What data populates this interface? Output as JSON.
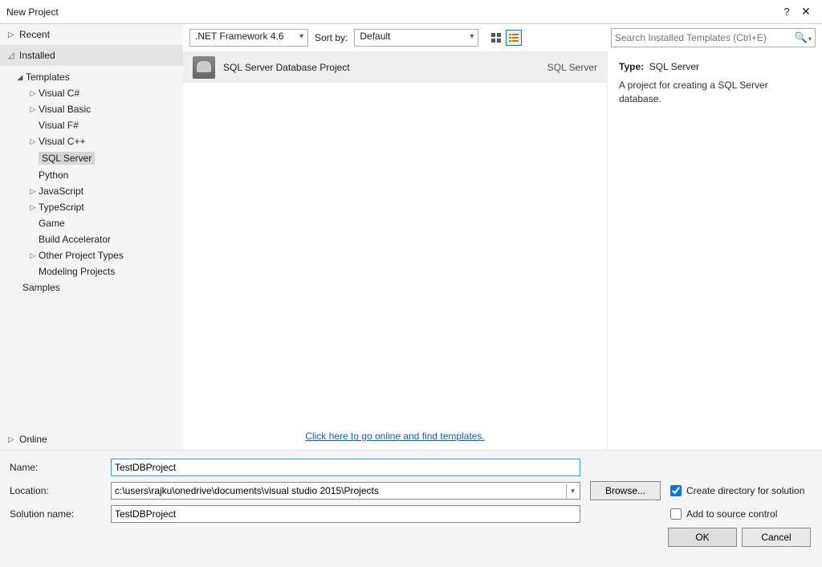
{
  "window": {
    "title": "New Project"
  },
  "nav": {
    "recent": "Recent",
    "installed": "Installed",
    "online": "Online",
    "templates": "Templates",
    "samples": "Samples",
    "items": [
      {
        "label": "Visual C#",
        "expandable": true
      },
      {
        "label": "Visual Basic",
        "expandable": true
      },
      {
        "label": "Visual F#",
        "expandable": false
      },
      {
        "label": "Visual C++",
        "expandable": true
      },
      {
        "label": "SQL Server",
        "expandable": false,
        "selected": true
      },
      {
        "label": "Python",
        "expandable": false
      },
      {
        "label": "JavaScript",
        "expandable": true
      },
      {
        "label": "TypeScript",
        "expandable": true
      },
      {
        "label": "Game",
        "expandable": false
      },
      {
        "label": "Build Accelerator",
        "expandable": false
      },
      {
        "label": "Other Project Types",
        "expandable": true
      },
      {
        "label": "Modeling Projects",
        "expandable": false
      }
    ]
  },
  "filter": {
    "framework": ".NET Framework 4.6",
    "sort_label": "Sort by:",
    "sort_value": "Default",
    "search_placeholder": "Search Installed Templates (Ctrl+E)"
  },
  "templates": [
    {
      "name": "SQL Server Database Project",
      "lang": "SQL Server"
    }
  ],
  "online_link": "Click here to go online and find templates.",
  "info": {
    "type_label": "Type:",
    "type_value": "SQL Server",
    "description": "A project for creating a SQL Server database."
  },
  "form": {
    "name_label": "Name:",
    "name_value": "TestDBProject",
    "location_label": "Location:",
    "location_value": "c:\\users\\rajku\\onedrive\\documents\\visual studio 2015\\Projects",
    "browse_label": "Browse...",
    "solution_label": "Solution name:",
    "solution_value": "TestDBProject",
    "chk_createdir": "Create directory for solution",
    "chk_source": "Add to source control",
    "ok": "OK",
    "cancel": "Cancel"
  }
}
